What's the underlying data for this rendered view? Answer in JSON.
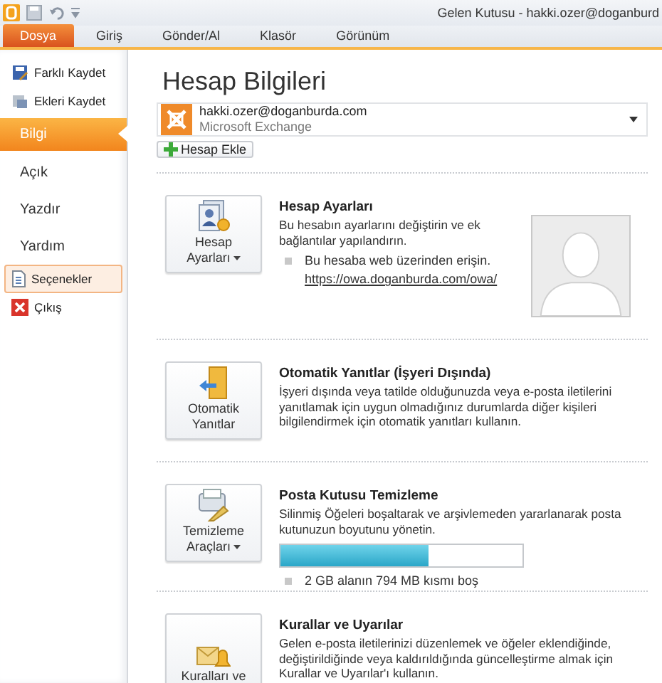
{
  "window": {
    "title": "Gelen Kutusu - hakki.ozer@doganburd"
  },
  "quick_access": [
    {
      "kind": "app"
    },
    {
      "kind": "save"
    },
    {
      "kind": "undo"
    },
    {
      "kind": "customize"
    }
  ],
  "tabs": [
    {
      "label": "Dosya",
      "selected": true
    },
    {
      "label": "Giriş",
      "selected": false
    },
    {
      "label": "Gönder/Al",
      "selected": false
    },
    {
      "label": "Klasör",
      "selected": false
    },
    {
      "label": "Görünüm",
      "selected": false
    }
  ],
  "sidebar": {
    "items": [
      {
        "kind": "command",
        "label": "Farklı Kaydet",
        "selected": false,
        "hovered": false
      },
      {
        "kind": "command",
        "label": "Ekleri Kaydet",
        "selected": false,
        "hovered": false
      },
      {
        "kind": "page",
        "label": "Bilgi",
        "selected": true,
        "hovered": false
      },
      {
        "kind": "page",
        "label": "Açık",
        "selected": false,
        "hovered": false
      },
      {
        "kind": "page",
        "label": "Yazdır",
        "selected": false,
        "hovered": false
      },
      {
        "kind": "page",
        "label": "Yardım",
        "selected": false,
        "hovered": false
      },
      {
        "kind": "command",
        "label": "Seçenekler",
        "selected": false,
        "hovered": true
      },
      {
        "kind": "command",
        "label": "Çıkış",
        "selected": false,
        "hovered": false
      }
    ]
  },
  "heading": "Hesap Bilgileri",
  "account": {
    "email": "hakki.ozer@doganburda.com",
    "type": "Microsoft Exchange"
  },
  "add_account_button": "Hesap Ekle",
  "sections": [
    {
      "button": [
        "Hesap",
        "Ayarları"
      ],
      "dropdown": true,
      "title": "Hesap Ayarları",
      "description": "Bu hesabın ayarlarını değiştirin ve ek bağlantılar yapılandırın.",
      "bullet": "Bu hesaba web üzerinden erişin.",
      "link": "https://owa.doganburda.com/owa/",
      "photo": true
    },
    {
      "button": [
        "Otomatik",
        "Yanıtlar"
      ],
      "dropdown": false,
      "title": "Otomatik Yanıtlar (İşyeri Dışında)",
      "description": "İşyeri dışında veya tatilde olduğunuzda veya e-posta iletilerini yanıtlamak için uygun olmadığınız durumlarda diğer kişileri bilgilendirmek için otomatik yanıtları kullanın."
    },
    {
      "button": [
        "Temizleme",
        "Araçları"
      ],
      "dropdown": true,
      "title": "Posta Kutusu Temizleme",
      "description": "Silinmiş Öğeleri boşaltarak ve arşivlemeden yararlanarak posta kutunuzun boyutunu yönetin.",
      "meter": {
        "level": 0.61
      },
      "bullet": "2 GB alanın 794 MB kısmı boş"
    },
    {
      "button": [
        "Kuralları ve"
      ],
      "dropdown": false,
      "title": "Kurallar ve Uyarılar",
      "description": "Gelen e-posta iletilerinizi düzenlemek ve öğeler eklendiğinde, değiştirildiğinde veya kaldırıldığında güncelleştirme almak için Kurallar ve Uyarılar'ı kullanın."
    }
  ]
}
